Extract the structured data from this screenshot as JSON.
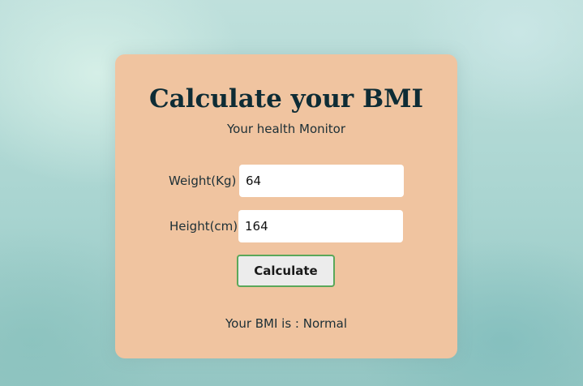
{
  "app": {
    "title": "Calculate your BMI",
    "subtitle": "Your health Monitor"
  },
  "form": {
    "weight": {
      "label": "Weight(Kg)",
      "value": "64"
    },
    "height": {
      "label": "Height(cm)",
      "value": "164"
    },
    "calculate_label": "Calculate"
  },
  "result": {
    "text": "Your BMI is : Normal"
  },
  "colors": {
    "card": "#f0c4a0",
    "title": "#0e2c35",
    "button_border": "#5aa85a"
  }
}
